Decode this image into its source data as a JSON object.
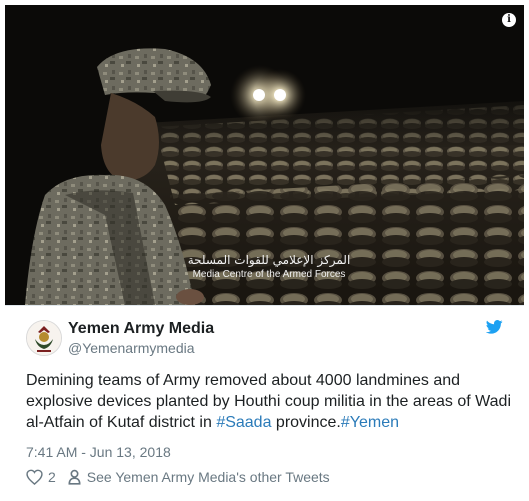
{
  "media": {
    "info_glyph": "i",
    "watermark_ar": "المركز الإعلامي للقوات المسلحة",
    "watermark_en": "Media Centre of the Armed Forces"
  },
  "tweet": {
    "display_name": "Yemen Army Media",
    "handle": "@Yemenarmymedia",
    "text_part1": "Demining teams of Army removed about 4000 landmines and explosive devices planted by Houthi coup militia in the areas of Wadi al-Atfain of Kutaf district in ",
    "hashtag_saada": "#Saada",
    "text_part2": " province.",
    "hashtag_yemen": "#Yemen",
    "timestamp": "7:41 AM - Jun 13, 2018",
    "like_count": "2",
    "other_tweets_link": "See Yemen Army Media's other Tweets"
  },
  "icons": {
    "info": "info-icon",
    "twitter": "twitter-bird-icon",
    "like": "heart-icon",
    "profile": "person-icon"
  },
  "colors": {
    "link": "#2b7bb9",
    "twitter_blue": "#1da1f2",
    "muted": "#697882",
    "text": "#1c2022"
  }
}
